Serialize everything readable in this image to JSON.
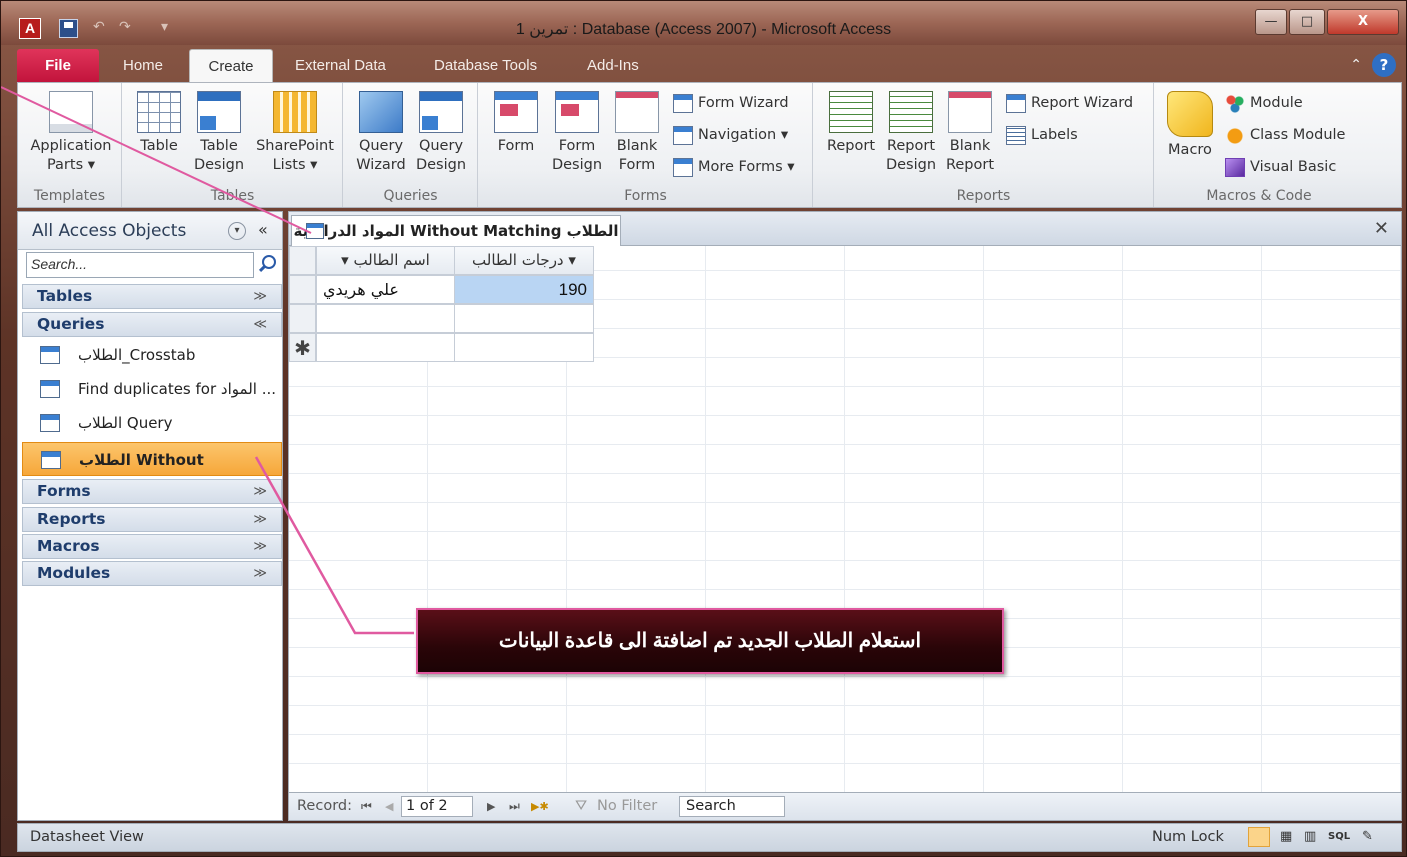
{
  "titlebar": {
    "title": "تمرين 1 : Database (Access 2007)  -  Microsoft Access",
    "minimize": "—",
    "maximize": "□",
    "close": "X"
  },
  "tabs": [
    {
      "label": "File"
    },
    {
      "label": "Home"
    },
    {
      "label": "Create"
    },
    {
      "label": "External Data"
    },
    {
      "label": "Database Tools"
    },
    {
      "label": "Add-Ins"
    }
  ],
  "ribbon": {
    "templates": {
      "app_parts_1": "Application",
      "app_parts_2": "Parts ▾",
      "label": "Templates"
    },
    "tables": {
      "table": "Table",
      "table_design_1": "Table",
      "table_design_2": "Design",
      "sp_1": "SharePoint",
      "sp_2": "Lists ▾",
      "label": "Tables"
    },
    "queries": {
      "wiz_1": "Query",
      "wiz_2": "Wizard",
      "design_1": "Query",
      "design_2": "Design",
      "label": "Queries"
    },
    "forms": {
      "form": "Form",
      "fd_1": "Form",
      "fd_2": "Design",
      "blank_1": "Blank",
      "blank_2": "Form",
      "wizard": "Form Wizard",
      "navigation": "Navigation ▾",
      "more": "More Forms ▾",
      "label": "Forms"
    },
    "reports": {
      "report": "Report",
      "rd_1": "Report",
      "rd_2": "Design",
      "blank_1": "Blank",
      "blank_2": "Report",
      "wizard": "Report Wizard",
      "labels": "Labels",
      "label": "Reports"
    },
    "macros": {
      "macro": "Macro",
      "module": "Module",
      "class_module": "Class Module",
      "vb": "Visual Basic",
      "label": "Macros & Code"
    }
  },
  "nav": {
    "title": "All Access Objects",
    "search_placeholder": "Search...",
    "sections": {
      "tables": "Tables",
      "queries": "Queries",
      "forms": "Forms",
      "reports": "Reports",
      "macros": "Macros",
      "modules": "Modules"
    },
    "queries": [
      {
        "label": "الطلاب_Crosstab"
      },
      {
        "label": "Find duplicates for المواد ..."
      },
      {
        "label": "الطلاب Query"
      },
      {
        "label": "الطلاب Without Matchin..."
      }
    ]
  },
  "document": {
    "tab_label": "المواد الدراسية Without Matching الطلاب",
    "columns": [
      "درجات الطالب ▾",
      "▾  اسم الطالب"
    ],
    "rows": [
      {
        "grade": "190",
        "name": "علي هريدي"
      }
    ],
    "new_row_marker": "✱",
    "record_nav": {
      "label": "Record:",
      "first": "⏮",
      "prev": "◀",
      "position": "1 of 2",
      "next": "▶",
      "last": "⏭",
      "new": "▶✱",
      "filter": "No Filter",
      "search": "Search"
    }
  },
  "status": {
    "left": "Datasheet View",
    "numlock": "Num Lock",
    "sql": "SQL"
  },
  "callout": {
    "text": "استعلام الطلاب الجديد تم اضافتة الى قاعدة البيانات",
    "border_color": "#e05aa0"
  },
  "colors": {
    "file_tab": "#c2143c",
    "selected_item": "#f6a73a",
    "selected_cell": "#b9d5f3"
  }
}
